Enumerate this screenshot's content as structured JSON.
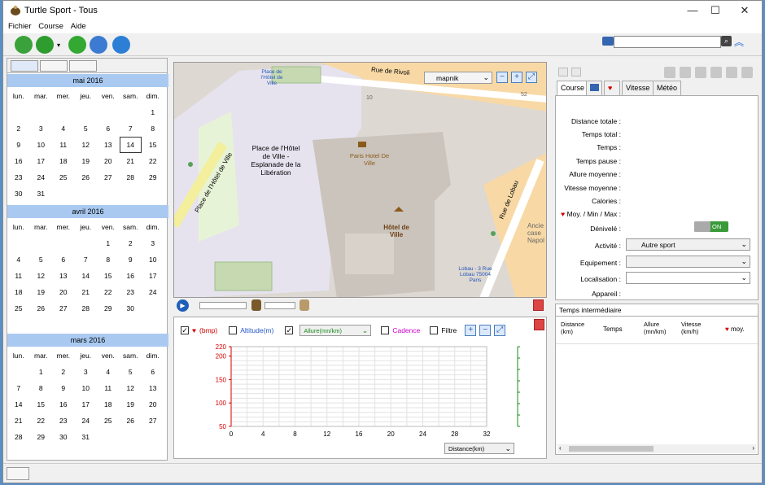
{
  "window": {
    "title": "Turtle Sport - Tous",
    "minimize": "—",
    "maximize": "☐",
    "close": "✕"
  },
  "menu": [
    "Fichier",
    "Course",
    "Aide"
  ],
  "calendar": {
    "weekdays": [
      "lun.",
      "mar.",
      "mer.",
      "jeu.",
      "ven.",
      "sam.",
      "dim."
    ],
    "months": [
      {
        "title": "mai 2016",
        "weeks": [
          [
            "",
            "",
            "",
            "",
            "",
            "",
            "1"
          ],
          [
            "2",
            "3",
            "4",
            "5",
            "6",
            "7",
            "8"
          ],
          [
            "9",
            "10",
            "11",
            "12",
            "13",
            "14",
            "15"
          ],
          [
            "16",
            "17",
            "18",
            "19",
            "20",
            "21",
            "22"
          ],
          [
            "23",
            "24",
            "25",
            "26",
            "27",
            "28",
            "29"
          ],
          [
            "30",
            "31",
            "",
            "",
            "",
            "",
            ""
          ]
        ]
      },
      {
        "title": "avril 2016",
        "weeks": [
          [
            "",
            "",
            "",
            "",
            "1",
            "2",
            "3"
          ],
          [
            "4",
            "5",
            "6",
            "7",
            "8",
            "9",
            "10"
          ],
          [
            "11",
            "12",
            "13",
            "14",
            "15",
            "16",
            "17"
          ],
          [
            "18",
            "19",
            "20",
            "21",
            "22",
            "23",
            "24"
          ],
          [
            "25",
            "26",
            "27",
            "28",
            "29",
            "30",
            ""
          ]
        ]
      },
      {
        "title": "mars 2016",
        "weeks": [
          [
            "",
            "1",
            "2",
            "3",
            "4",
            "5",
            "6"
          ],
          [
            "7",
            "8",
            "9",
            "10",
            "11",
            "12",
            "13"
          ],
          [
            "14",
            "15",
            "16",
            "17",
            "18",
            "19",
            "20"
          ],
          [
            "21",
            "22",
            "23",
            "24",
            "25",
            "26",
            "27"
          ],
          [
            "28",
            "29",
            "30",
            "31",
            "",
            "",
            ""
          ]
        ]
      }
    ]
  },
  "map": {
    "provider": "mapnik",
    "labels": {
      "street_top": "Rue de Rivoli",
      "place": "Place de l'Hôtel de Ville - Esplanade de la Libération",
      "paris_hotel": "Paris Hotel De Ville",
      "hotel_de_ville": "Hôtel de Ville",
      "street_left": "Place de l'Hôtel de Ville",
      "street_right": "Rue de Lobau",
      "place_small": "Place de l'Hôtel de Ville",
      "lobau": "Lobau - 3 Rue Lobau 75004 Paris",
      "ancie": "Ancie case Napol",
      "num_52": "52",
      "num_10": "10"
    }
  },
  "chart_controls": {
    "bpm": "(bmp)",
    "altitude": "Altitude(m)",
    "allure": "Allure(mn/km)",
    "cadence": "Cadence",
    "filtre": "Filtre",
    "distance": "Distance(km)"
  },
  "chart_data": {
    "type": "line",
    "title": "",
    "xlabel": "Distance(km)",
    "ylabel": "(bmp)",
    "xlim": [
      0,
      32
    ],
    "ylim": [
      50,
      220
    ],
    "x_ticks": [
      "0",
      "4",
      "8",
      "12",
      "16",
      "20",
      "24",
      "28",
      "32"
    ],
    "y_ticks": [
      "220",
      "200",
      "150",
      "100",
      "50"
    ],
    "series": []
  },
  "right": {
    "tabs": [
      "Course",
      "Vitesse",
      "Météo"
    ],
    "fields": [
      "Distance totale :",
      "Temps total :",
      "Temps :",
      "Temps pause :",
      "Allure moyenne :",
      "Vitesse moyenne :",
      "Calories :",
      "Moy. / Min / Max :",
      "Dénivelé :",
      "Activité :",
      "Equipement :",
      "Localisation :",
      "Appareil :"
    ],
    "toggle": "ON",
    "activite": "Autre sport",
    "interm_title": "Temps intermédiaire",
    "interm_cols": [
      "Distance (km)",
      "Temps",
      "Allure (mn/km)",
      "Vitesse (km/h)",
      "moy."
    ]
  },
  "colors": {
    "calendar_header": "#a9c9f0",
    "heart": "#d40000",
    "altitude": "#2255cc",
    "cadence": "#cc00cc",
    "allure": "#1a8a1a"
  }
}
